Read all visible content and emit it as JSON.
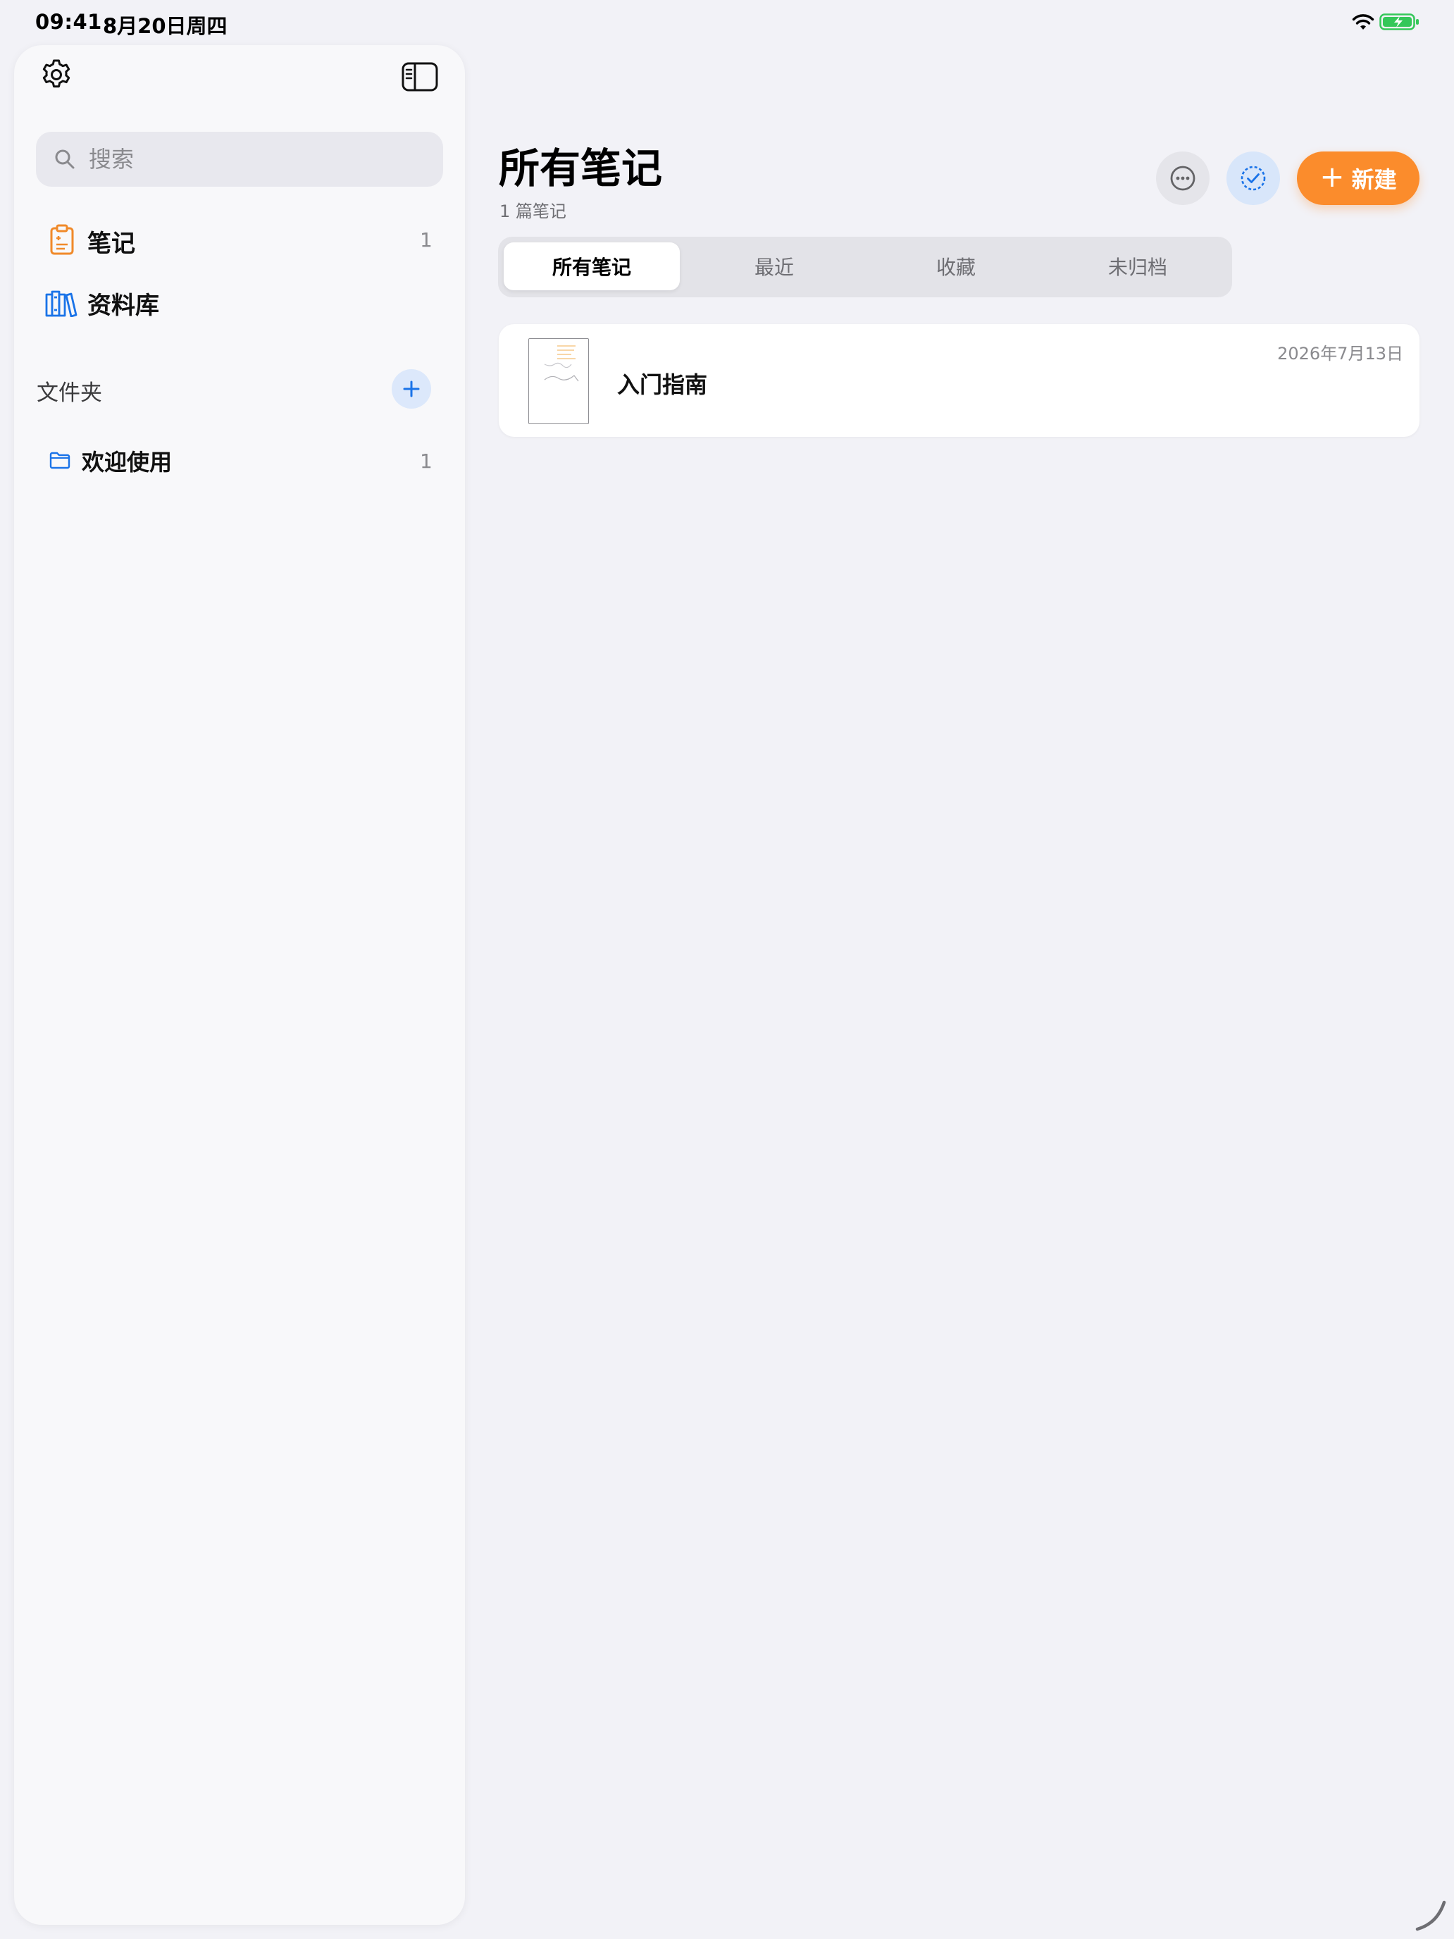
{
  "status_bar": {
    "time": "09:41",
    "date": "8月20日周四"
  },
  "sidebar": {
    "search": {
      "placeholder": "搜索"
    },
    "items": [
      {
        "label": "笔记",
        "count": "1"
      },
      {
        "label": "资料库"
      }
    ],
    "folders_title": "文件夹",
    "folders": [
      {
        "label": "欢迎使用",
        "count": "1"
      }
    ]
  },
  "main": {
    "title": "所有笔记",
    "subtitle": "1 篇笔记",
    "new_button_label": "新建",
    "tabs": [
      {
        "label": "所有笔记",
        "active": true
      },
      {
        "label": "最近"
      },
      {
        "label": "收藏"
      },
      {
        "label": "未归档"
      }
    ],
    "notes": [
      {
        "title": "入门指南",
        "date": "2026年7月13日"
      }
    ]
  },
  "colors": {
    "accent_orange": "#fb8c2c",
    "accent_blue": "#1a73e8",
    "battery_green": "#34c759"
  },
  "icons": [
    "gear-icon",
    "sidebar-toggle-icon",
    "search-icon",
    "notes-icon",
    "library-icon",
    "plus-icon",
    "folder-icon",
    "ellipsis-icon",
    "checkmark-circle-icon"
  ]
}
